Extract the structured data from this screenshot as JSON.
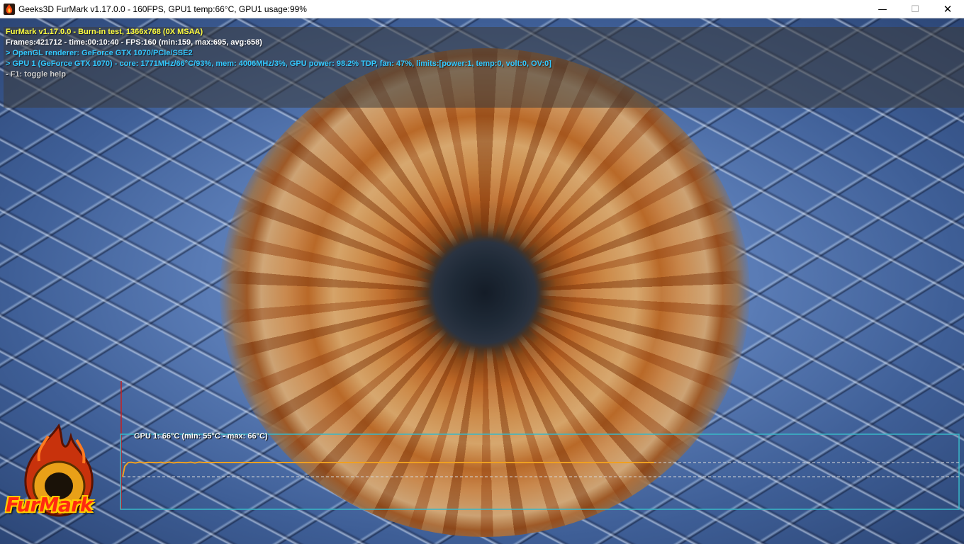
{
  "window": {
    "title": "Geeks3D FurMark v1.17.0.0 - 160FPS, GPU1 temp:66°C, GPU1 usage:99%",
    "icon": "furmark-flame-icon",
    "controls": {
      "minimize": "—",
      "maximize": "☐",
      "close": "✕"
    }
  },
  "overlay": {
    "line1": "FurMark v1.17.0.0 - Burn-in test, 1366x768 (0X MSAA)",
    "line2": "Frames:421712 - time:00:10:40 - FPS:160 (min:159, max:695, avg:658)",
    "line3": "> OpenGL renderer: GeForce GTX 1070/PCIe/SSE2",
    "line4": "> GPU 1 (GeForce GTX 1070) - core: 1771MHz/66°C/93%, mem: 4006MHz/3%, GPU power: 98.2% TDP, fan: 47%, limits:[power:1, temp:0, volt:0, OV:0]",
    "line5": "- F1: toggle help"
  },
  "logo": {
    "text": "FurMark"
  },
  "temperature_graph": {
    "label": "GPU 1: 66°C (min: 55°C - max: 66°C)",
    "current_c": 66,
    "min_c": 55,
    "max_c": 66,
    "colors": {
      "line": "#f0a020",
      "frame": "#38b8c8",
      "axis": "#c82020",
      "reference": "#d8d8d8"
    },
    "fill_fraction": 0.64
  }
}
